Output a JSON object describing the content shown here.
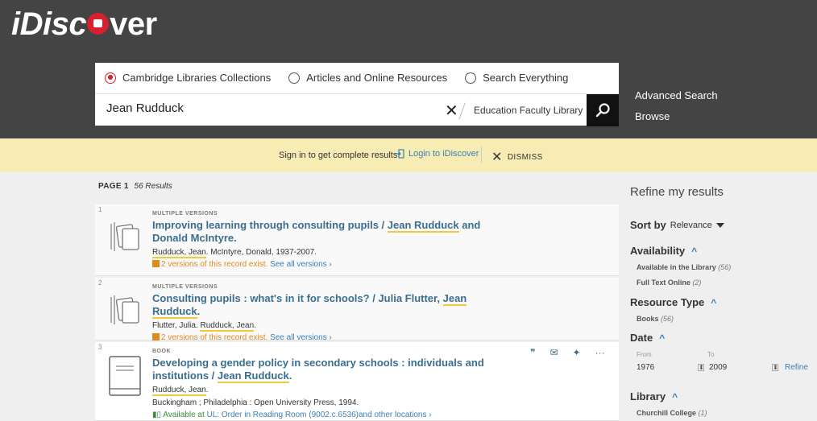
{
  "header": {
    "logo_text_1": "iDisc",
    "logo_text_2": "ver"
  },
  "search": {
    "scopes": [
      {
        "label": "Cambridge Libraries Collections",
        "selected": true
      },
      {
        "label": "Articles and Online Resources",
        "selected": false
      },
      {
        "label": "Search Everything",
        "selected": false
      }
    ],
    "query": "Jean Rudduck",
    "clear_label": "✕",
    "library": "Education Faculty Library",
    "advanced_search": "Advanced Search",
    "browse": "Browse"
  },
  "banner": {
    "text": "Sign in to get complete results",
    "login": "Login to iDiscover",
    "dismiss": "DISMISS"
  },
  "results_info": {
    "page": "PAGE 1",
    "count": "56 Results"
  },
  "results": [
    {
      "num": "1",
      "type": "MULTIPLE VERSIONS",
      "title_a": "Improving learning through consulting pupils / ",
      "title_hl": "Jean Rudduck",
      "title_b": " and Donald McIntyre.",
      "authors_hl": "Rudduck, Jean",
      "authors_rest": ". McIntyre, Donald, 1937-2007.",
      "versions": "2 versions of this record exist.",
      "see_all": "See all versions ›"
    },
    {
      "num": "2",
      "type": "MULTIPLE VERSIONS",
      "title_a": "Consulting pupils : what's in it for schools? / Julia Flutter, ",
      "title_hl": "Jean Rudduck",
      "title_b": ".",
      "authors_pre": "Flutter, Julia. ",
      "authors_hl": "Rudduck, Jean",
      "authors_rest": ".",
      "versions": "2 versions of this record exist.",
      "see_all": "See all versions ›"
    },
    {
      "num": "3",
      "type": "BOOK",
      "title_a": "Developing a gender policy in secondary schools : individuals and institutions / ",
      "title_hl": "Jean Rudduck",
      "title_b": ".",
      "authors_hl": "Rudduck, Jean",
      "authors_rest": ".",
      "publisher": "Buckingham ; Philadelphia : Open University Press, 1994.",
      "avail_label": "Available at",
      "avail_loc": "UL: Order in Reading Room  (9002.c.6536)and other locations ›"
    }
  ],
  "actions": {
    "cite": "❞",
    "email": "✉",
    "pin": "✦",
    "more": "···"
  },
  "facets": {
    "heading": "Refine my results",
    "sort_label": "Sort by",
    "sort_value": "Relevance",
    "availability": "Availability",
    "avail_library": "Available in the Library",
    "avail_library_count": "(56)",
    "avail_fulltext": "Full Text Online",
    "avail_fulltext_count": "(2)",
    "resource_type": "Resource Type",
    "books": "Books",
    "books_count": "(56)",
    "date": "Date",
    "from_label": "From",
    "to_label": "To",
    "from_value": "1976",
    "to_value": "2009",
    "refine": "Refine",
    "library": "Library",
    "churchill": "Churchill College",
    "churchill_count": "(1)"
  },
  "colors": {
    "header_bg": "#444444",
    "banner_bg": "#f7ecb3",
    "link_blue": "#3a7fb4",
    "title_blue": "#3a6e8f",
    "accent_red": "#d6202f",
    "orange": "#e08a1c",
    "highlight_yellow": "#f2c93d"
  }
}
